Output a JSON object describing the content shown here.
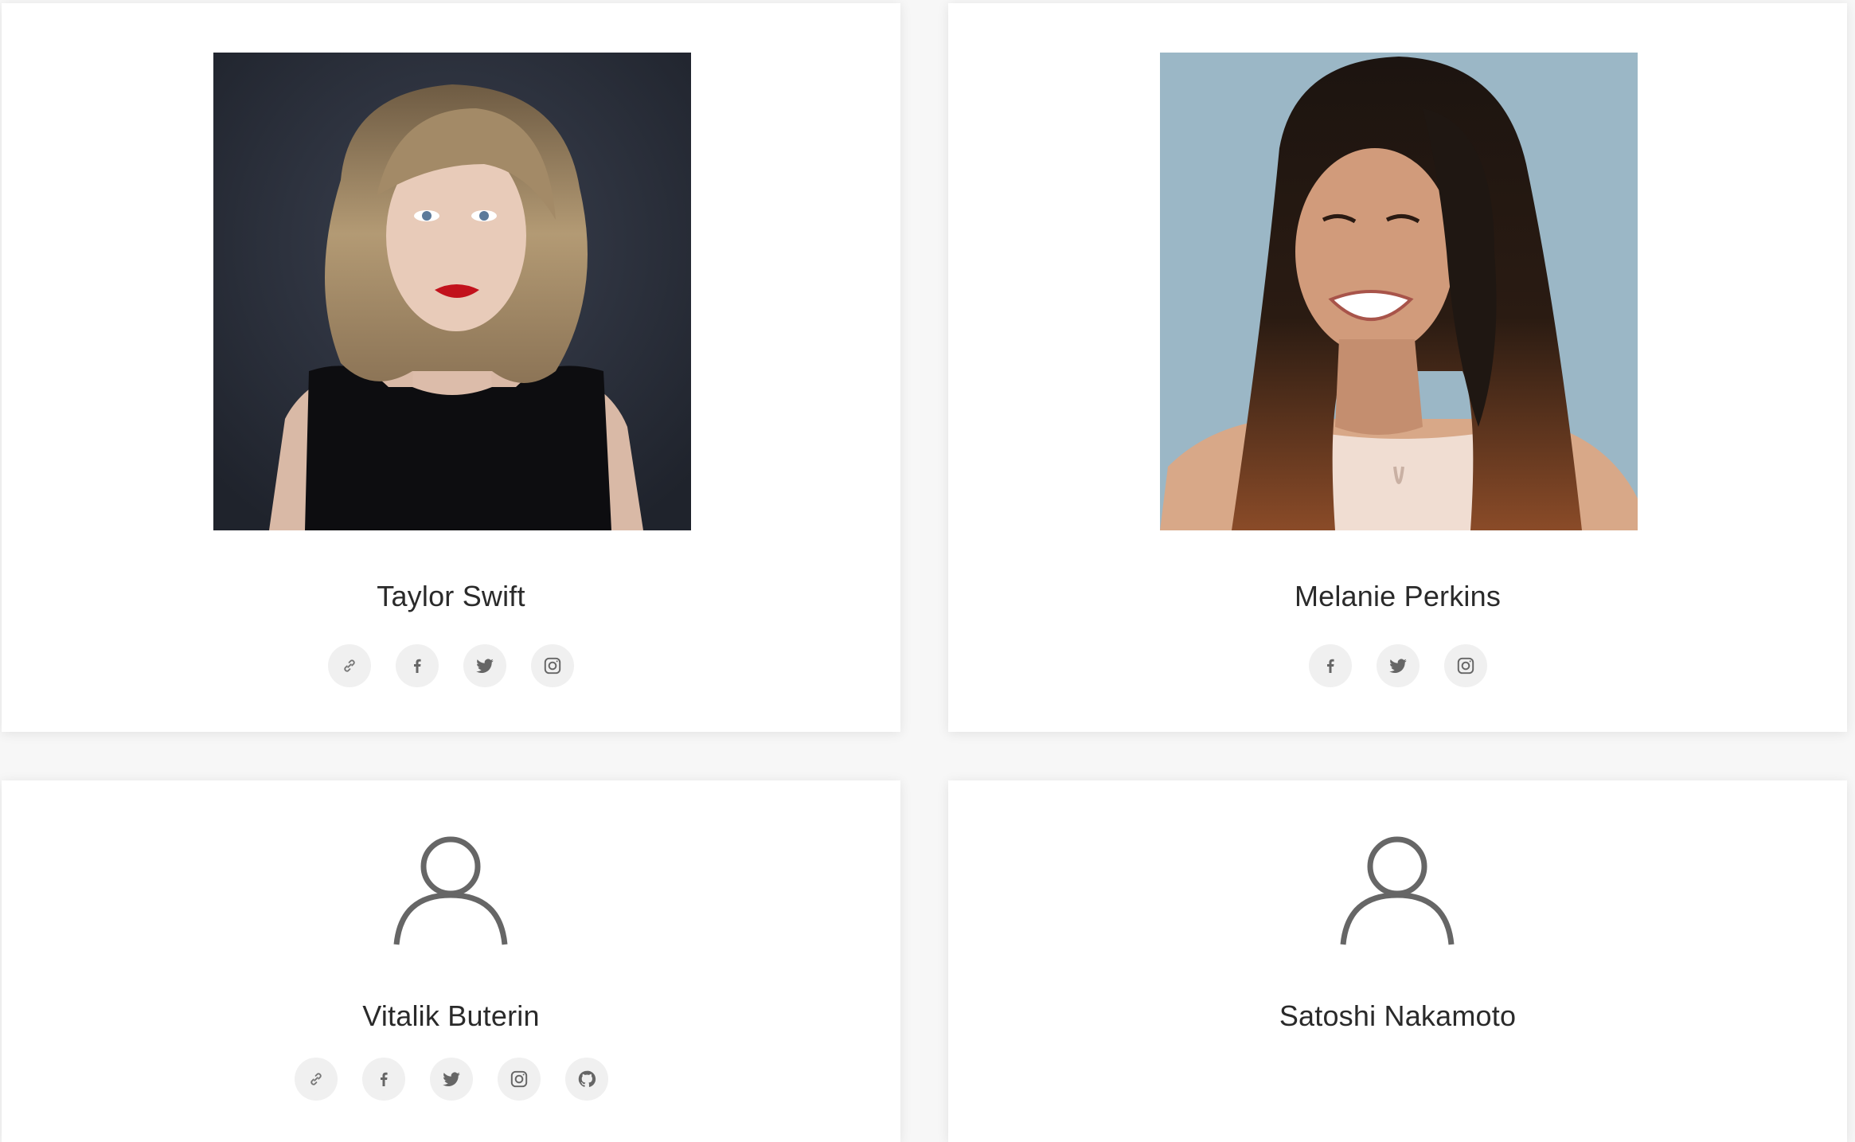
{
  "team": {
    "members": [
      {
        "name": "Taylor Swift",
        "photo_alt": "Taylor Swift",
        "socials": [
          "link-icon",
          "facebook-icon",
          "twitter-icon",
          "instagram-icon"
        ]
      },
      {
        "name": "Melanie Perkins",
        "photo_alt": "Melanie Perkins",
        "socials": [
          "facebook-icon",
          "twitter-icon",
          "instagram-icon"
        ]
      },
      {
        "name": "Vitalik Buterin",
        "socials": [
          "link-icon",
          "facebook-icon",
          "twitter-icon",
          "instagram-icon",
          "github-icon"
        ]
      },
      {
        "name": "Satoshi Nakamoto",
        "socials": []
      }
    ]
  },
  "colors": {
    "page_background": "#f7f7f7",
    "card_background": "#ffffff",
    "icon_button_background": "#f0f0f0",
    "icon_color": "#666666"
  }
}
